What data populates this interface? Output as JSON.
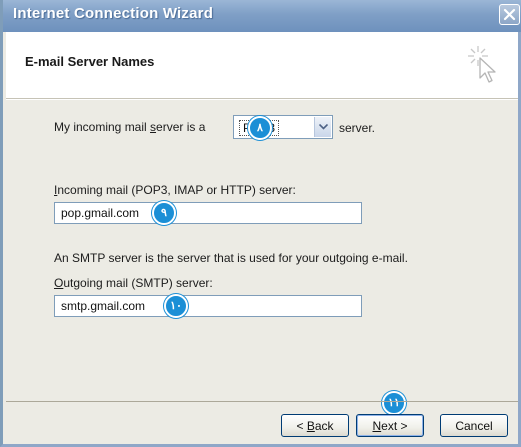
{
  "window": {
    "title": "Internet Connection Wizard"
  },
  "header": {
    "title": "E-mail Server Names",
    "icon": "wizard-cursor-icon"
  },
  "incoming_type": {
    "prefix": "My incoming mail ",
    "prefix_ul": "s",
    "prefix_rest": "erver is a",
    "selected": "POP3",
    "suffix": "server."
  },
  "incoming_server": {
    "label_ul": "I",
    "label_rest": "ncoming mail (POP3, IMAP or HTTP) server:",
    "value": "pop.gmail.com"
  },
  "smtp_note": "An SMTP server is the server that is used for your outgoing e-mail.",
  "outgoing_server": {
    "label_ul": "O",
    "label_rest": "utgoing mail (SMTP) server:",
    "value": "smtp.gmail.com"
  },
  "markers": {
    "m8": "٨",
    "m9": "٩",
    "m10": "١٠",
    "m11": "١١"
  },
  "buttons": {
    "back_pre": "< ",
    "back_ul": "B",
    "back_rest": "ack",
    "next_ul": "N",
    "next_rest": "ext >",
    "cancel": "Cancel"
  },
  "colors": {
    "titlebar": "#7f9fc6",
    "marker": "#1b8fd6"
  }
}
